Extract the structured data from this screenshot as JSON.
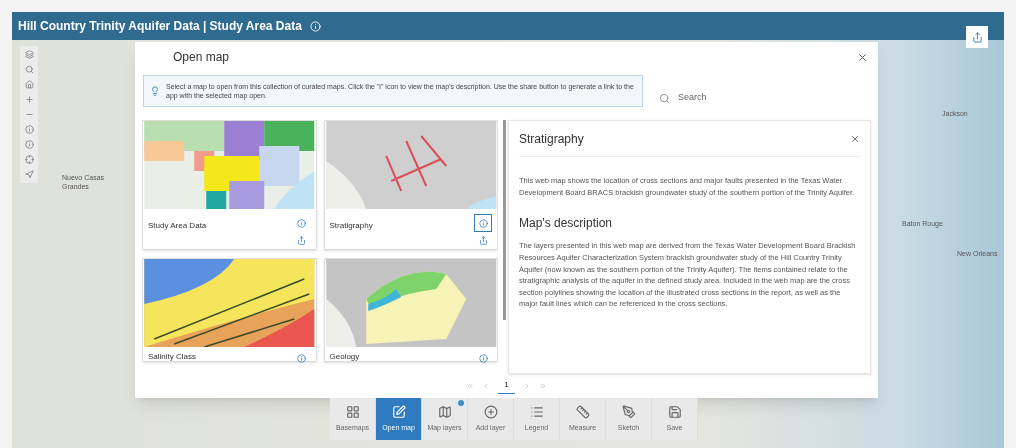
{
  "header": {
    "title": "Hill Country Trinity Aquifer Data | Study Area Data"
  },
  "map_labels": [
    {
      "text": "Nuevo Casas Grandes"
    },
    {
      "text": "Jackson"
    },
    {
      "text": "Baton Rouge"
    },
    {
      "text": "New Orleans"
    }
  ],
  "modal": {
    "title": "Open map",
    "notice": "Select a map to open from this collection of curated maps. Click the \"i\" icon to view the map's description. Use the share button to generate a link to the app with the selected map open.",
    "search": {
      "placeholder": "Search"
    },
    "maps": [
      {
        "title": "Study Area Data",
        "info_open": false
      },
      {
        "title": "Stratigraphy",
        "info_open": true
      },
      {
        "title": "Salinity Class",
        "info_open": false
      },
      {
        "title": "Geology",
        "info_open": false
      }
    ],
    "detail": {
      "title": "Stratigraphy",
      "summary": "This web map shows the location of cross sections and major faults presented in the Texas Water Development Board BRACS brackish groundwater study of the southern portion of the Trinity Aquifer.",
      "heading": "Map's description",
      "description": "The layers presented in this web map are derived from the Texas Water Development Board Brackish Resources Aquifer Characterization System brackish groundwater study of the Hill Country Trinity Aquifer (now known as the southern portion of the Trinity Aquifer). The items contained relate to the stratigraphic analysis of the aquifer in the defined study area. Included in the web map are the cross section polylines showing the location of the illustrated cross sections in the report, as well as the major fault lines which can be referenced in the cross sections."
    },
    "pages": [
      {
        "label": "1",
        "selected": true
      }
    ]
  },
  "toolbar": [
    {
      "label": "Basemaps",
      "selected": false,
      "badge": false
    },
    {
      "label": "Open map",
      "selected": true,
      "badge": false
    },
    {
      "label": "Map layers",
      "selected": false,
      "badge": true
    },
    {
      "label": "Add layer",
      "selected": false,
      "badge": false
    },
    {
      "label": "Legend",
      "selected": false,
      "badge": false
    },
    {
      "label": "Measure",
      "selected": false,
      "badge": false
    },
    {
      "label": "Sketch",
      "selected": false,
      "badge": false
    },
    {
      "label": "Save",
      "selected": false,
      "badge": false
    }
  ]
}
